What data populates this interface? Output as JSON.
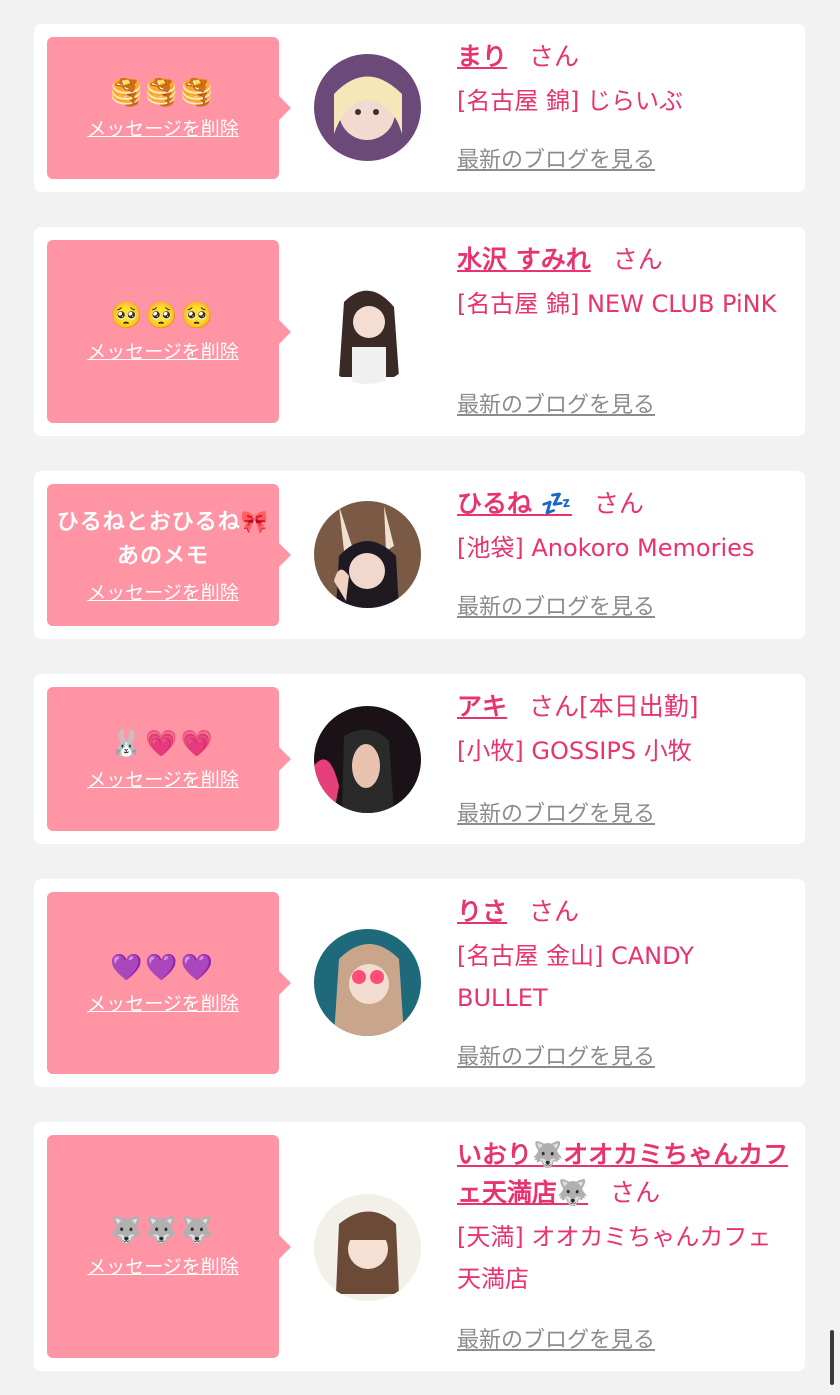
{
  "delete_label": "メッセージを削除",
  "blog_label": "最新のブログを見る",
  "san_label": "さん",
  "items": [
    {
      "message": "🥞🥞🥞",
      "name": "まり",
      "extra": "",
      "shop": "[名古屋 錦] じらいぶ"
    },
    {
      "message": "🥺🥺🥺",
      "name": "水沢 すみれ",
      "extra": "",
      "shop": "[名古屋 錦] NEW CLUB PiNK"
    },
    {
      "message": "ひるねとおひるね🎀あのメモ",
      "name": "ひるね 💤",
      "extra": "",
      "shop": "[池袋] Anokoro Memories"
    },
    {
      "message": "🐰💗💗",
      "name": "アキ",
      "extra": "[本日出勤]",
      "shop": "[小牧] GOSSIPS 小牧"
    },
    {
      "message": "💜💜💜",
      "name": "りさ",
      "extra": "",
      "shop": "[名古屋 金山] CANDY BULLET"
    },
    {
      "message": "🐺🐺🐺",
      "name": "いおり🐺オオカミちゃんカフェ天満店🐺",
      "extra": "",
      "shop": "[天満] オオカミちゃんカフェ天満店"
    }
  ]
}
